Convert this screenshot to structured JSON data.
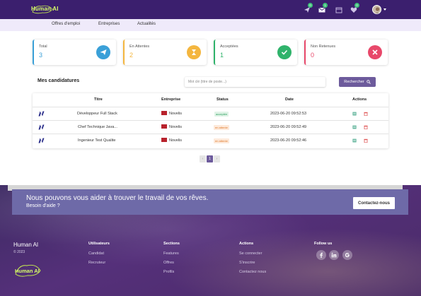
{
  "header": {
    "brand": "Human AI",
    "badges": {
      "send": "0",
      "mail": "1",
      "heart": "0"
    }
  },
  "nav": {
    "items": [
      "Offres d'emploi",
      "Entreprises",
      "Actualités"
    ]
  },
  "stats": [
    {
      "label": "Total",
      "value": "3",
      "color": "#3aa0d8",
      "icon": "paper-plane-icon"
    },
    {
      "label": "En Attentes",
      "value": "2",
      "color": "#f4b63f",
      "icon": "hourglass-icon"
    },
    {
      "label": "Acceptées",
      "value": "1",
      "color": "#2fb36b",
      "icon": "check-icon"
    },
    {
      "label": "Non Retenues",
      "value": "0",
      "color": "#e8486a",
      "icon": "close-icon"
    }
  ],
  "applications": {
    "title": "Mes candidatures",
    "search_placeholder": "Mot clé (titre de poste...)",
    "search_button": "Rechercher",
    "columns": [
      "Titre",
      "Entreprise",
      "Status",
      "Date",
      "Actions"
    ],
    "rows": [
      {
        "title": "Développeur Full Stack",
        "company": "Novelis",
        "status": "acceptée",
        "status_type": "accepted",
        "date": "2023-06-20 09:52:53"
      },
      {
        "title": "Chef Technique Java...",
        "company": "Novelis",
        "status": "en attente",
        "status_type": "pending",
        "date": "2023-06-20 09:52:49"
      },
      {
        "title": "Ingenieur Test Qualite",
        "company": "Novelis",
        "status": "en attente",
        "status_type": "pending",
        "date": "2023-06-20 09:52:46"
      }
    ]
  },
  "pagination": {
    "prev": "‹",
    "current": "1",
    "next": "›"
  },
  "cta": {
    "title": "Nous pouvons vous aider à trouver le travail de vos rêves.",
    "subtitle": "Besoin d'aide ?",
    "button": "Contactez-nous"
  },
  "footer": {
    "brand": "Human AI",
    "copyright": "© 2023",
    "columns": [
      {
        "heading": "Utilisateurs",
        "links": [
          "Candidat",
          "Recruteur"
        ]
      },
      {
        "heading": "Sections",
        "links": [
          "Features",
          "Offres",
          "Profils"
        ]
      },
      {
        "heading": "Actions",
        "links": [
          "Se connecter",
          "S'inscrire",
          "Contactez nous"
        ]
      }
    ],
    "follow_heading": "Follow us",
    "social": [
      "facebook-icon",
      "linkedin-icon",
      "google-icon"
    ]
  },
  "colors": {
    "header_bg": "#3b1f6e",
    "nav_bg": "#efeafa",
    "primary_button": "#6d5b9c",
    "accepted": "#2fb36b",
    "pending": "#f08a3a"
  }
}
